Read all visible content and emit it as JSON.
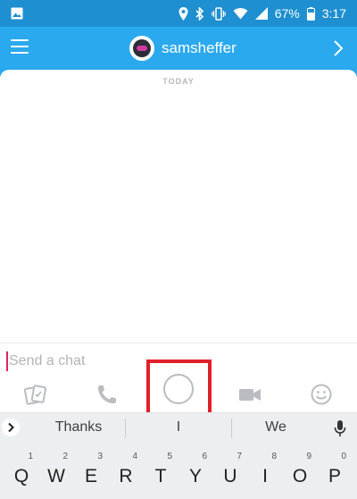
{
  "status_bar": {
    "battery": "67%",
    "time": "3:17"
  },
  "header": {
    "username": "samsheffer"
  },
  "chat": {
    "date_label": "TODAY"
  },
  "input": {
    "placeholder": "Send a chat"
  },
  "suggestions": [
    "Thanks",
    "I",
    "We"
  ],
  "keyboard": {
    "row1": [
      {
        "hint": "1",
        "char": "Q"
      },
      {
        "hint": "2",
        "char": "W"
      },
      {
        "hint": "3",
        "char": "E"
      },
      {
        "hint": "4",
        "char": "R"
      },
      {
        "hint": "5",
        "char": "T"
      },
      {
        "hint": "6",
        "char": "Y"
      },
      {
        "hint": "7",
        "char": "U"
      },
      {
        "hint": "8",
        "char": "I"
      },
      {
        "hint": "9",
        "char": "O"
      },
      {
        "hint": "0",
        "char": "P"
      }
    ]
  },
  "colors": {
    "header_bg": "#2aa9ee",
    "status_bg": "#1e8fd0",
    "highlight": "#e0202a",
    "icon_gray": "#b9bcc0"
  }
}
